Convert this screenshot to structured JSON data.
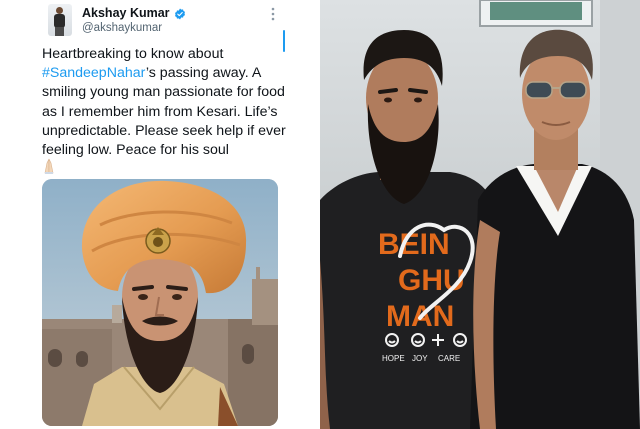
{
  "tweet": {
    "author_name": "Akshay Kumar",
    "author_handle": "@akshaykumar",
    "text_before_hashtag": "Heartbreaking to know about",
    "hashtag": "#SandeepNahar",
    "text_after_hashtag": "’s passing away. A smiling young man passionate for food as I remember him from Kesari. Life’s unpredictable. Please seek help if ever feeling low. Peace for his soul",
    "emoji_icon": "folded-hands-icon",
    "verified_icon": "verified-badge-icon",
    "menu_icon": "more-options-icon",
    "accent_color": "#1d9bf0"
  },
  "photo_right": {
    "shirt_text_lines": [
      "BEIN",
      "GHU",
      "MAN"
    ],
    "shirt_icon_labels": [
      "HOPE",
      "JOY",
      "CARE"
    ]
  }
}
